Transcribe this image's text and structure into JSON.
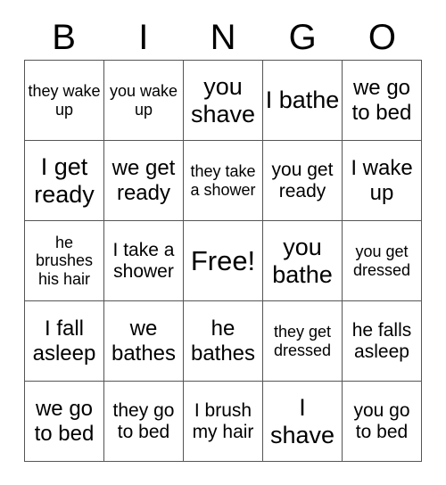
{
  "card": {
    "title": "BINGO",
    "header_letters": [
      "B",
      "I",
      "N",
      "G",
      "O"
    ],
    "free_space_label": "Free!",
    "grid_size": "5x5",
    "rows": [
      [
        {
          "text": "they wake up",
          "size": "s-sm"
        },
        {
          "text": "you wake up",
          "size": "s-sm"
        },
        {
          "text": "you shave",
          "size": "s-xl"
        },
        {
          "text": "I bathe",
          "size": "s-xl"
        },
        {
          "text": "we go to bed",
          "size": "s-lg"
        }
      ],
      [
        {
          "text": "I get ready",
          "size": "s-xl"
        },
        {
          "text": "we get ready",
          "size": "s-lg"
        },
        {
          "text": "they take a shower",
          "size": "s-sm"
        },
        {
          "text": "you get ready",
          "size": "s-md"
        },
        {
          "text": "I wake up",
          "size": "s-lg"
        }
      ],
      [
        {
          "text": "he brushes his hair",
          "size": "s-sm"
        },
        {
          "text": "I take a shower",
          "size": "s-md"
        },
        {
          "text": "Free!",
          "size": "s-free"
        },
        {
          "text": "you bathe",
          "size": "s-xl"
        },
        {
          "text": "you get dressed",
          "size": "s-sm"
        }
      ],
      [
        {
          "text": "I fall asleep",
          "size": "s-lg"
        },
        {
          "text": "we bathes",
          "size": "s-lg"
        },
        {
          "text": "he bathes",
          "size": "s-lg"
        },
        {
          "text": "they get dressed",
          "size": "s-sm"
        },
        {
          "text": "he falls asleep",
          "size": "s-md"
        }
      ],
      [
        {
          "text": "we go to bed",
          "size": "s-lg"
        },
        {
          "text": "they go to bed",
          "size": "s-md"
        },
        {
          "text": "I brush my hair",
          "size": "s-md"
        },
        {
          "text": "I shave",
          "size": "s-xl"
        },
        {
          "text": "you go to bed",
          "size": "s-md"
        }
      ]
    ]
  },
  "colors": {
    "background": "#ffffff",
    "text": "#000000",
    "grid_line": "#555555"
  }
}
